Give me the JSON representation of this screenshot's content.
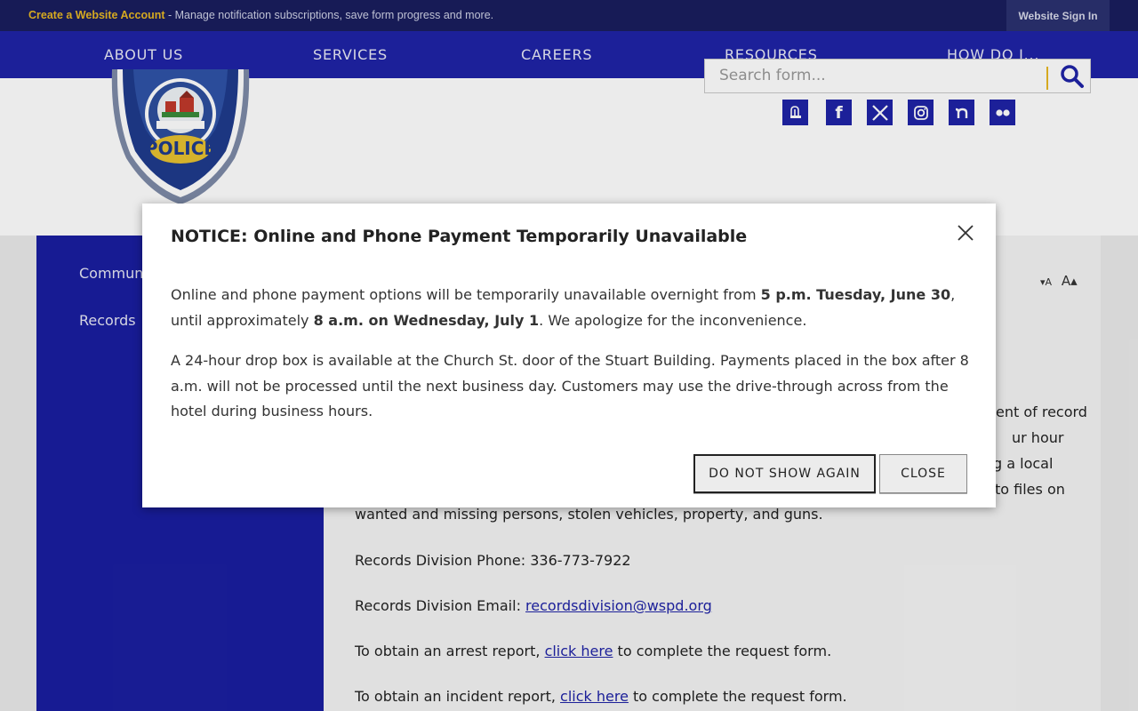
{
  "topbar": {
    "create_label": "Create a Website Account",
    "create_desc": " - Manage notification subscriptions, save form progress and more.",
    "signin_label": "Website Sign In"
  },
  "nav": {
    "items": [
      "ABOUT US",
      "SERVICES",
      "CAREERS",
      "RESOURCES",
      "HOW DO I..."
    ]
  },
  "header": {
    "search_placeholder": "Search form...",
    "social_icons": [
      "cloud-icon",
      "facebook-icon",
      "x-twitter-icon",
      "instagram-icon",
      "nextdoor-icon",
      "flickr-icon"
    ],
    "logo_alt": "Winston-Salem Police badge"
  },
  "sidebar": {
    "items": [
      "Community",
      "Records"
    ]
  },
  "content": {
    "font_size_controls": "A A",
    "partial_lines": [
      "ent of record",
      "ur hour",
      "g a local",
      "to files on"
    ],
    "line_wanted": "wanted and missing persons, stolen vehicles, property, and guns.",
    "phone_line": "Records Division Phone: 336-773-7922",
    "email_prefix": "Records Division Email: ",
    "email_link": "recordsdivision@wspd.org",
    "arrest_prefix": "To obtain an arrest report, ",
    "arrest_link": "click here",
    "arrest_suffix": " to complete the request form.",
    "incident_prefix": "To obtain an incident report, ",
    "incident_link": "click here",
    "incident_suffix": " to complete the request form."
  },
  "modal": {
    "title": "NOTICE: Online and Phone Payment Temporarily Unavailable",
    "p1_a": "Online and phone payment options will be temporarily unavailable overnight from ",
    "p1_b": "5 p.m. Tuesday, June 30",
    "p1_c": ", until approximately ",
    "p1_d": "8 a.m. on Wednesday, July 1",
    "p1_e": ". We apologize for the inconvenience.",
    "p2": "A 24-hour drop box is available at the Church St. door of the Stuart Building. Payments placed in the box after 8 a.m. will not be processed until the next business day. Customers may use the drive-through across from the hotel during business hours.",
    "btn_dont_show": "DO NOT SHOW AGAIN",
    "btn_close": "CLOSE"
  },
  "colors": {
    "nav": "#1f23a6",
    "topbar": "#1a1e5e",
    "accent": "#e8b823"
  }
}
